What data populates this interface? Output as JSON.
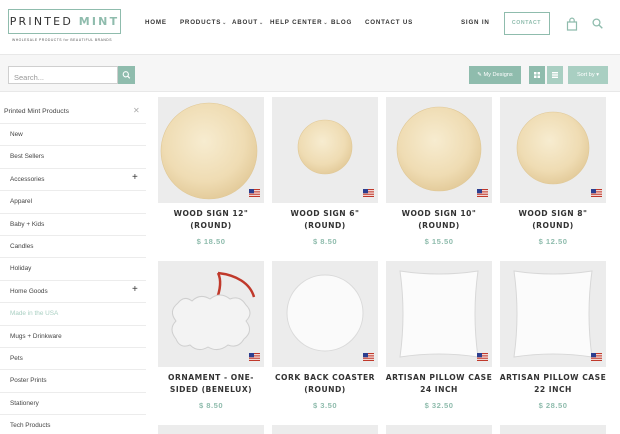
{
  "header": {
    "logo": {
      "word1": "PRINTED ",
      "word2": "MINT",
      "tagline": "WHOLESALE PRODUCTS for BEAUTIFUL BRANDS"
    },
    "nav": [
      {
        "label": "HOME",
        "dropdown": false
      },
      {
        "label": "PRODUCTS",
        "dropdown": true
      },
      {
        "label": "ABOUT",
        "dropdown": true
      },
      {
        "label": "HELP CENTER",
        "dropdown": true
      },
      {
        "label": "BLOG",
        "dropdown": false
      },
      {
        "label": "CONTACT US",
        "dropdown": false
      }
    ],
    "sign_in": "SIGN IN",
    "contact": "CONTACT",
    "brand_color": "#8fbcad",
    "icons": [
      "shopping-bag-icon",
      "search-icon"
    ]
  },
  "toolbar": {
    "search_placeholder": "Search...",
    "my_designs": "My Designs",
    "sort_by": "Sort by",
    "icons": [
      "search-icon",
      "pencil-icon",
      "grid-view-icon",
      "list-view-icon",
      "caret-down-icon"
    ]
  },
  "sidebar": {
    "title": "Printed Mint Products",
    "items": [
      {
        "label": "New",
        "expandable": false,
        "active": false
      },
      {
        "label": "Best Sellers",
        "expandable": false,
        "active": false
      },
      {
        "label": "Accessories",
        "expandable": true,
        "active": false
      },
      {
        "label": "Apparel",
        "expandable": false,
        "active": false
      },
      {
        "label": "Baby + Kids",
        "expandable": false,
        "active": false
      },
      {
        "label": "Candles",
        "expandable": false,
        "active": false
      },
      {
        "label": "Holiday",
        "expandable": false,
        "active": false
      },
      {
        "label": "Home Goods",
        "expandable": true,
        "active": false
      },
      {
        "label": "Made in the USA",
        "expandable": false,
        "active": true
      },
      {
        "label": "Mugs + Drinkware",
        "expandable": false,
        "active": false
      },
      {
        "label": "Pets",
        "expandable": false,
        "active": false
      },
      {
        "label": "Poster Prints",
        "expandable": false,
        "active": false
      },
      {
        "label": "Stationery",
        "expandable": false,
        "active": false
      },
      {
        "label": "Tech Products",
        "expandable": false,
        "active": false
      }
    ]
  },
  "products": [
    {
      "name_line1": "WOOD SIGN 12\"",
      "name_line2": "(ROUND)",
      "price": "$ 18.50",
      "image": "wood-circle-large"
    },
    {
      "name_line1": "WOOD SIGN 6\"",
      "name_line2": "(ROUND)",
      "price": "$ 8.50",
      "image": "wood-circle-small"
    },
    {
      "name_line1": "WOOD SIGN 10\"",
      "name_line2": "(ROUND)",
      "price": "$ 15.50",
      "image": "wood-circle-medium"
    },
    {
      "name_line1": "WOOD SIGN 8\"",
      "name_line2": "(ROUND)",
      "price": "$ 12.50",
      "image": "wood-circle-8"
    },
    {
      "name_line1": "ORNAMENT - ONE-",
      "name_line2": "SIDED (BENELUX)",
      "price": "$ 8.50",
      "image": "ornament"
    },
    {
      "name_line1": "CORK BACK COASTER",
      "name_line2": "(ROUND)",
      "price": "$ 3.50",
      "image": "coaster"
    },
    {
      "name_line1": "ARTISAN PILLOW CASE",
      "name_line2": "24 INCH",
      "price": "$ 32.50",
      "image": "pillow"
    },
    {
      "name_line1": "ARTISAN PILLOW CASE",
      "name_line2": "22 INCH",
      "price": "$ 28.50",
      "image": "pillow"
    }
  ],
  "flag_icon": "us-flag-icon"
}
